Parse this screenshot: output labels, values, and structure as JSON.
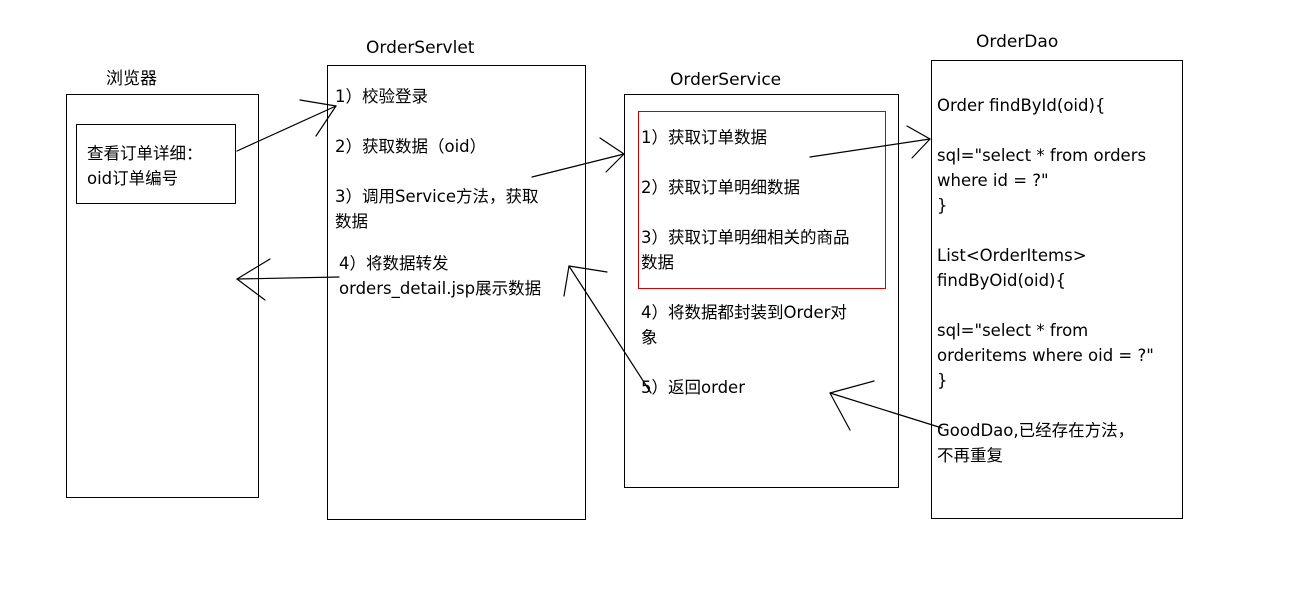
{
  "browser": {
    "title": "浏览器",
    "note": "查看订单详细：\noid订单编号"
  },
  "servlet": {
    "title": "OrderServlet",
    "steps": [
      "1）校验登录",
      "2）获取数据（oid）",
      "3）调用Service方法，获取\n数据",
      "4）将数据转发\norders_detail.jsp展示数据"
    ]
  },
  "service": {
    "title": "OrderService",
    "steps": [
      "1）获取订单数据",
      "2）获取订单明细数据",
      "3）获取订单明细相关的商品\n数据",
      "4）将数据都封装到Order对\n象",
      "5）返回order"
    ]
  },
  "dao": {
    "title": "OrderDao",
    "blocks": [
      "Order findById(oid){",
      "sql=\"select * from orders\nwhere id = ?\"\n}",
      "List<OrderItems>\nfindByOid(oid){",
      "sql=\"select * from\norderitems where oid = ?\"\n}",
      "GoodDao,已经存在方法，\n不再重复"
    ]
  },
  "colors": {
    "line": "#000000",
    "highlight": "#d00000"
  }
}
